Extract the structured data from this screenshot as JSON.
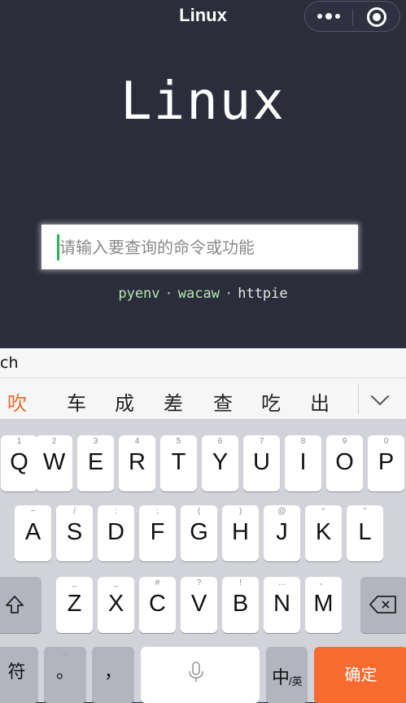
{
  "navbar": {
    "title": "Linux"
  },
  "logo": {
    "text": "Linux"
  },
  "search": {
    "placeholder": "请输入要查询的命令或功能",
    "value": ""
  },
  "suggestions": [
    {
      "label": "pyenv"
    },
    {
      "label": "wacaw"
    },
    {
      "label": "httpie"
    }
  ],
  "suggestion_separator": "·",
  "ime": {
    "pinyin": "ch",
    "candidates": [
      "吹",
      "车",
      "成",
      "差",
      "查",
      "吃",
      "出"
    ],
    "row1": [
      {
        "hint": "1",
        "key": "Q"
      },
      {
        "hint": "2",
        "key": "W"
      },
      {
        "hint": "3",
        "key": "E"
      },
      {
        "hint": "4",
        "key": "R"
      },
      {
        "hint": "5",
        "key": "T"
      },
      {
        "hint": "6",
        "key": "Y"
      },
      {
        "hint": "7",
        "key": "U"
      },
      {
        "hint": "8",
        "key": "I"
      },
      {
        "hint": "9",
        "key": "O"
      },
      {
        "hint": "0",
        "key": "P"
      }
    ],
    "row2": [
      {
        "hint": "~",
        "key": "A"
      },
      {
        "hint": "/",
        "key": "S"
      },
      {
        "hint": ":",
        "key": "D"
      },
      {
        "hint": ";",
        "key": "F"
      },
      {
        "hint": "(",
        "key": "G"
      },
      {
        "hint": ")",
        "key": "H"
      },
      {
        "hint": "@",
        "key": "J"
      },
      {
        "hint": "“",
        "key": "K"
      },
      {
        "hint": "”",
        "key": "L"
      }
    ],
    "row3": [
      {
        "hint": "_",
        "key": "Z"
      },
      {
        "hint": "_",
        "key": "X"
      },
      {
        "hint": "#",
        "key": "C"
      },
      {
        "hint": "?",
        "key": "V"
      },
      {
        "hint": "!",
        "key": "B"
      },
      {
        "hint": "…",
        "key": "N"
      },
      {
        "hint": "、",
        "key": "M"
      }
    ],
    "bottom": {
      "symbol_key": "符",
      "period_hint": "…",
      "period_key": "。",
      "comma_key": "，",
      "lang_main": "中",
      "lang_sub": "/英",
      "confirm_key": "确定"
    }
  }
}
